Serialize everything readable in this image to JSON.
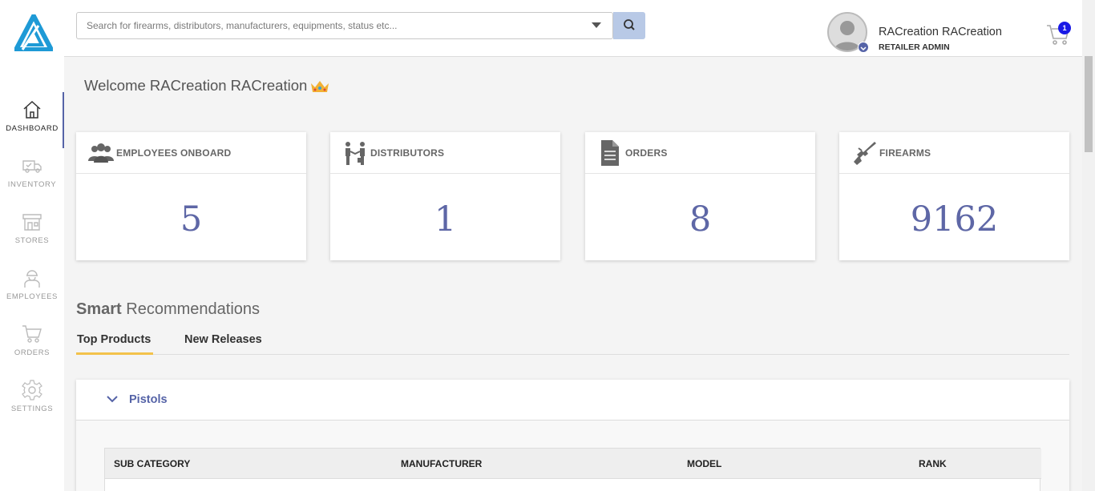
{
  "sidebar": {
    "items": [
      {
        "label": "DASHBOARD",
        "icon": "home-icon",
        "active": true
      },
      {
        "label": "INVENTORY",
        "icon": "truck-icon"
      },
      {
        "label": "STORES",
        "icon": "store-icon"
      },
      {
        "label": "EMPLOYEES",
        "icon": "worker-icon"
      },
      {
        "label": "ORDERS",
        "icon": "cart-icon"
      },
      {
        "label": "SETTINGS",
        "icon": "gear-icon"
      }
    ]
  },
  "header": {
    "search_placeholder": "Search for firearms, distributors, manufacturers, equipments, status etc...",
    "user_name": "RACreation RACreation",
    "user_role": "RETAILER ADMIN",
    "cart_count": "1"
  },
  "main": {
    "welcome": "Welcome RACreation RACreation",
    "cards": [
      {
        "title": "EMPLOYEES ONBOARD",
        "value": "5",
        "icon": "users-icon"
      },
      {
        "title": "DISTRIBUTORS",
        "value": "1",
        "icon": "handshake-icon"
      },
      {
        "title": "ORDERS",
        "value": "8",
        "icon": "document-icon"
      },
      {
        "title": "FIREARMS",
        "value": "9162",
        "icon": "rifle-icon"
      }
    ],
    "smart_bold": "Smart",
    "smart_rest": " Recommendations",
    "tabs": [
      {
        "label": "Top Products",
        "active": true
      },
      {
        "label": "New Releases"
      }
    ],
    "accordion": {
      "label": "Pistols",
      "columns": [
        "SUB CATEGORY",
        "MANUFACTURER",
        "MODEL",
        "RANK"
      ]
    }
  },
  "colors": {
    "accent": "#5563a7",
    "tab_underline": "#f3c24b",
    "cart_badge": "#1a1ae6",
    "logo": "#1e9ad6"
  }
}
